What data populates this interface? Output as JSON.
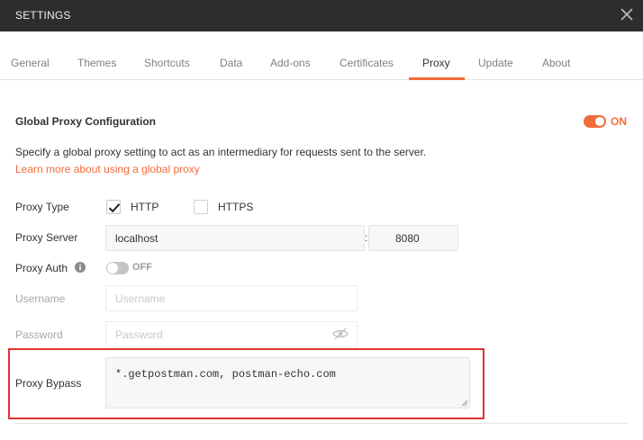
{
  "window": {
    "title": "SETTINGS"
  },
  "tabs": [
    {
      "label": "General"
    },
    {
      "label": "Themes"
    },
    {
      "label": "Shortcuts"
    },
    {
      "label": "Data"
    },
    {
      "label": "Add-ons"
    },
    {
      "label": "Certificates"
    },
    {
      "label": "Proxy",
      "active": true
    },
    {
      "label": "Update"
    },
    {
      "label": "About"
    }
  ],
  "proxy": {
    "section_title": "Global Proxy Configuration",
    "global_toggle": {
      "state": "ON",
      "on": true
    },
    "description": "Specify a global proxy setting to act as an intermediary for requests sent to the server.",
    "learn_more": "Learn more about using a global proxy",
    "proxy_type": {
      "label": "Proxy Type",
      "http": {
        "label": "HTTP",
        "checked": true
      },
      "https": {
        "label": "HTTPS",
        "checked": false
      }
    },
    "proxy_server": {
      "label": "Proxy Server",
      "host": "localhost",
      "separator": ":",
      "port": "8080"
    },
    "proxy_auth": {
      "label": "Proxy Auth",
      "toggle_state": "OFF",
      "on": false
    },
    "username": {
      "label": "Username",
      "placeholder": "Username",
      "value": ""
    },
    "password": {
      "label": "Password",
      "placeholder": "Password",
      "value": ""
    },
    "bypass": {
      "label": "Proxy Bypass",
      "value": "*.getpostman.com, postman-echo.com"
    }
  },
  "colors": {
    "accent": "#f26b3a",
    "titlebar": "#2d2d2d",
    "highlight": "#e0352b"
  },
  "icons": {
    "close": "close-icon",
    "info": "info-icon",
    "checkmark": "checkmark-icon",
    "eye_hidden": "eye-slash-icon"
  }
}
